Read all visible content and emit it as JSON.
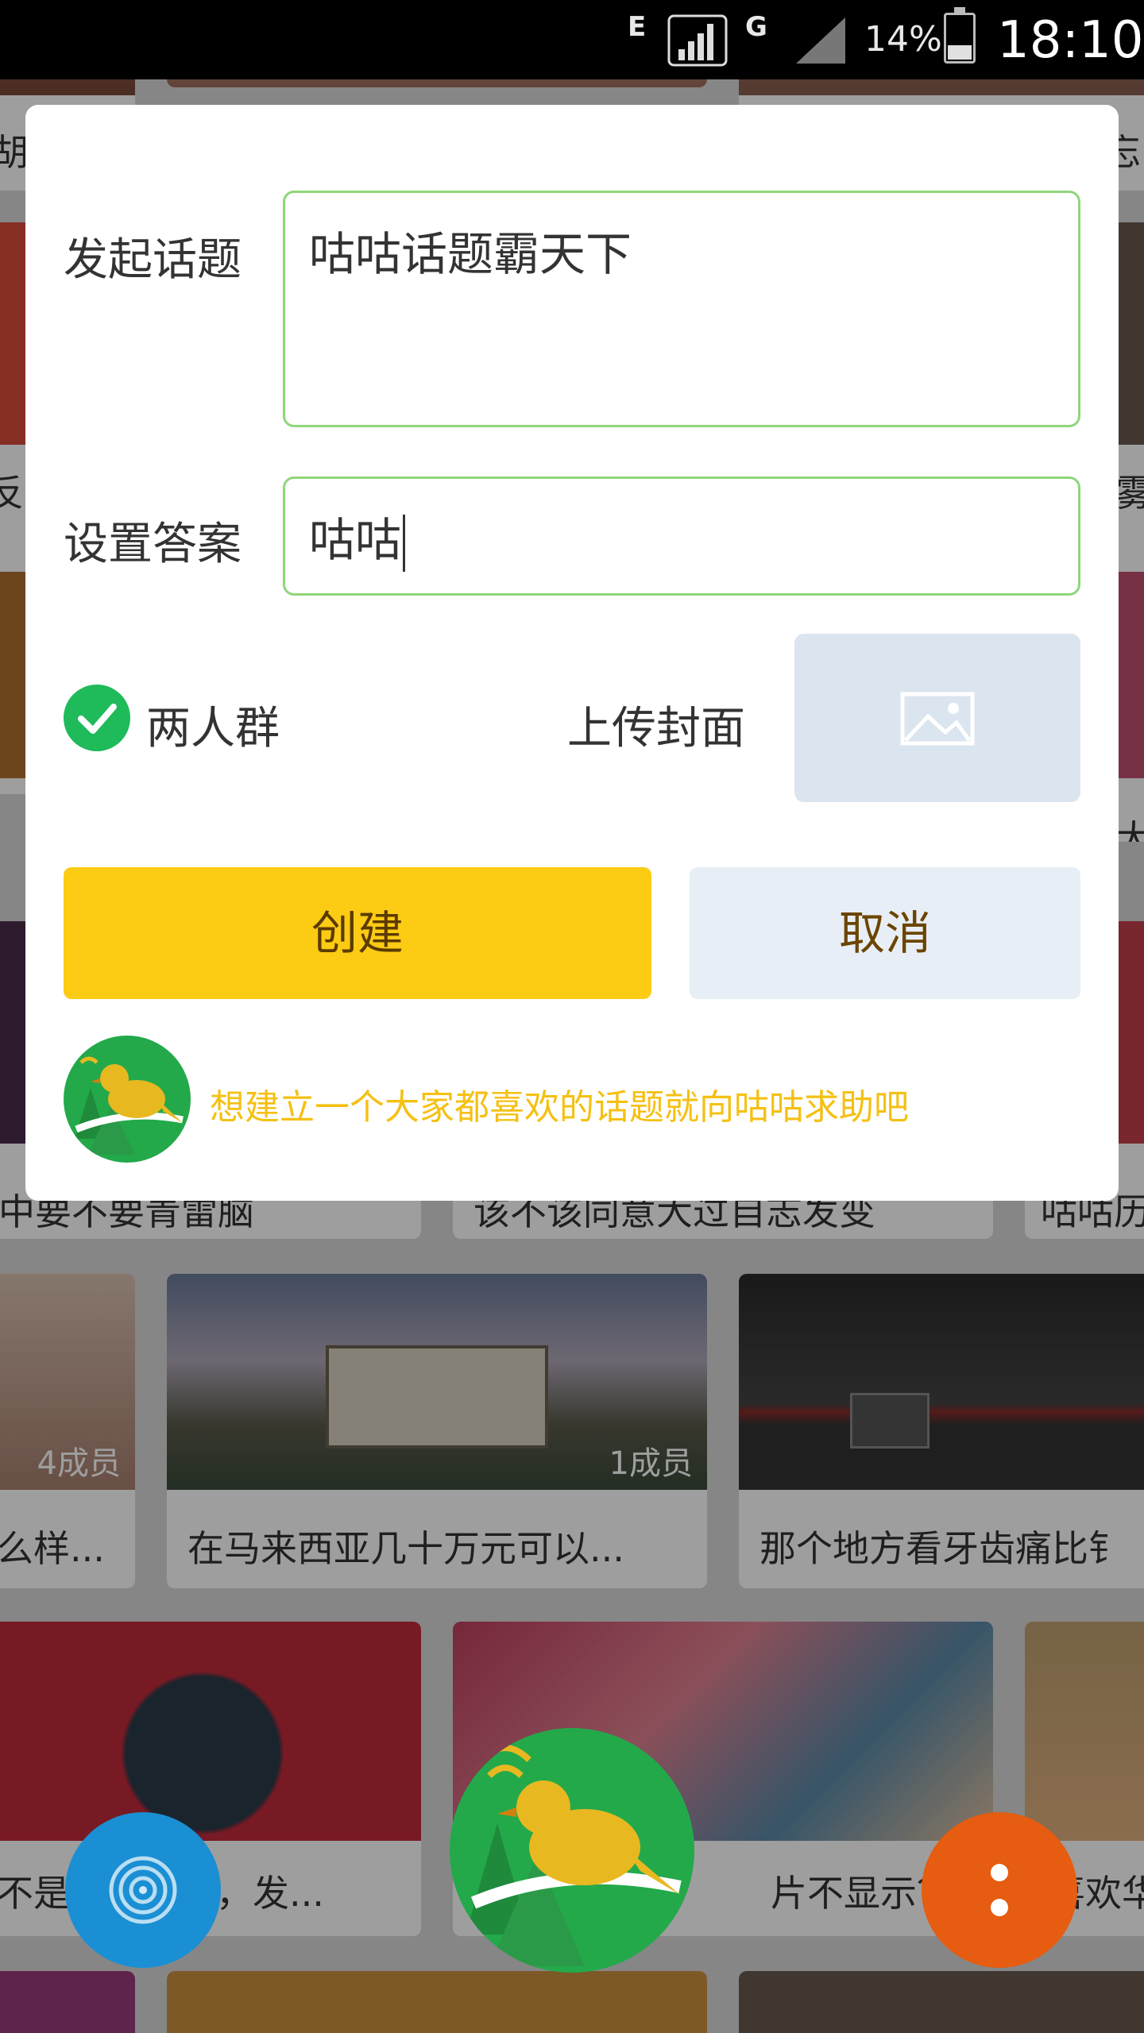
{
  "status_bar": {
    "network1": "E",
    "network2": "G",
    "battery": "14%",
    "time": "18:10"
  },
  "dialog": {
    "topic_label": "发起话题",
    "topic_value": "咕咕话题霸天下",
    "answer_label": "设置答案",
    "answer_value": "咕咕",
    "two_person_label": "两人群",
    "two_person_checked": true,
    "upload_cover_label": "上传封面",
    "create_button": "创建",
    "cancel_button": "取消",
    "help_text": "想建立一个大家都喜欢的话题就向咕咕求助吧"
  },
  "background_cards": {
    "row1": [
      "中要不要青雷脑",
      "该不该同意大过自志发变",
      "咕咕历"
    ],
    "row2": [
      {
        "title": "么样...",
        "members": "4成员"
      },
      {
        "title": "在马来西亚几十万元可以...",
        "members": "1成员"
      },
      {
        "title": "那个地方看牙齿痛比钅",
        "members": ""
      }
    ],
    "row3": [
      "不是不好发了，发...",
      "片不显示？",
      "喜欢华"
    ],
    "edge_left": [
      "胡",
      "反"
    ],
    "edge_right": [
      "忘",
      "雾",
      "大"
    ]
  },
  "colors": {
    "accent_yellow": "#fccb14",
    "field_border": "#8fd67a",
    "check_green": "#1fba5a",
    "help_text": "#f5c013",
    "cancel_bg": "#e8eef5"
  },
  "icons": {
    "check": "check-icon",
    "image": "image-placeholder-icon",
    "bird": "bird-logo-icon",
    "radio": "broadcast-icon",
    "more": "more-vertical-icon"
  }
}
